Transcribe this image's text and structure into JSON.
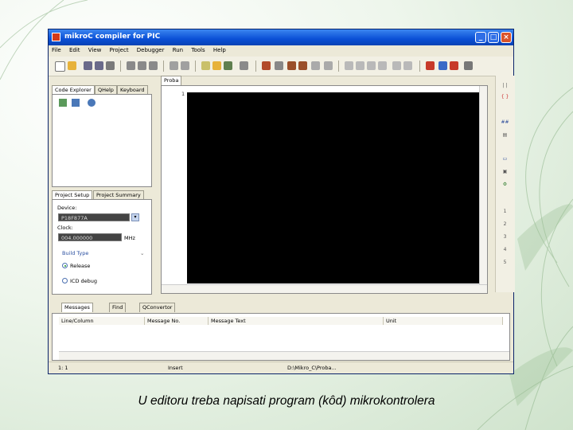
{
  "window": {
    "title": "mikroC compiler for PIC"
  },
  "menu": [
    "File",
    "Edit",
    "View",
    "Project",
    "Debugger",
    "Run",
    "Tools",
    "Help"
  ],
  "left_tabs": [
    "Code Explorer",
    "QHelp",
    "Keyboard"
  ],
  "project_tabs": [
    "Project Setup",
    "Project Summary"
  ],
  "project_setup": {
    "device_label": "Device:",
    "device_value": "P18F877A",
    "clock_label": "Clock:",
    "clock_value": "004.000000",
    "clock_unit": "MHz",
    "build_type_label": "Build Type",
    "release_label": "Release",
    "icd_label": "ICD debug"
  },
  "editor_tab": "Proba",
  "editor_line": "1",
  "message_tabs": [
    "Messages",
    "Find",
    "QConvertor"
  ],
  "message_columns": [
    "Line/Column",
    "Message No.",
    "Message Text",
    "Unit"
  ],
  "status": {
    "position": "1: 1",
    "mode": "Insert",
    "path": "D:\\Mikro_C\\Proba..."
  },
  "caption": "U editoru treba napisati program (kôd) mikrokontrolera",
  "colors": {
    "titlebar": "#0a4fd6",
    "editor_bg": "#000000",
    "window_bg": "#ece9d8"
  }
}
